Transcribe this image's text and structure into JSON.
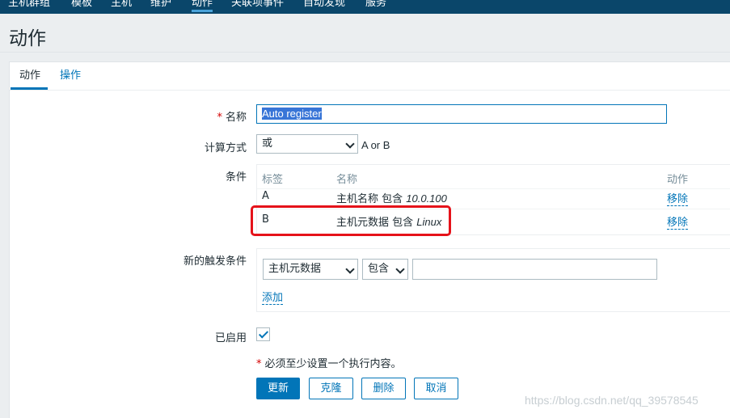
{
  "topnav": {
    "items": [
      "主机群组",
      "模板",
      "主机",
      "维护",
      "动作",
      "关联项事件",
      "自动发现",
      "服务"
    ],
    "active_index": 4
  },
  "page": {
    "title": "动作"
  },
  "tabs": [
    {
      "label": "动作",
      "active": true
    },
    {
      "label": "操作",
      "active": false
    }
  ],
  "form": {
    "name_label": "名称",
    "name_value": "Auto register",
    "calc_label": "计算方式",
    "calc_value": "或",
    "calc_expression": "A or B",
    "conditions_label": "条件",
    "conditions": {
      "headers": {
        "label": "标签",
        "name": "名称",
        "action": "动作"
      },
      "rows": [
        {
          "label": "A",
          "name": "主机名称 包含 ",
          "value": "10.0.100",
          "action": "移除"
        },
        {
          "label": "B",
          "name": "主机元数据 包含 ",
          "value": "Linux",
          "action": "移除"
        }
      ]
    },
    "new_condition_label": "新的触发条件",
    "new_condition": {
      "type_value": "主机元数据",
      "operator_value": "包含",
      "value": "",
      "add_link": "添加"
    },
    "enabled_label": "已启用",
    "enabled": true,
    "required_note": "必须至少设置一个执行内容。"
  },
  "buttons": {
    "update": "更新",
    "clone": "克隆",
    "delete": "删除",
    "cancel": "取消"
  },
  "watermark": "https://blog.csdn.net/qq_39578545",
  "colors": {
    "nav": "#0a466a",
    "accent": "#0275b8",
    "highlight": "#e5121a"
  }
}
